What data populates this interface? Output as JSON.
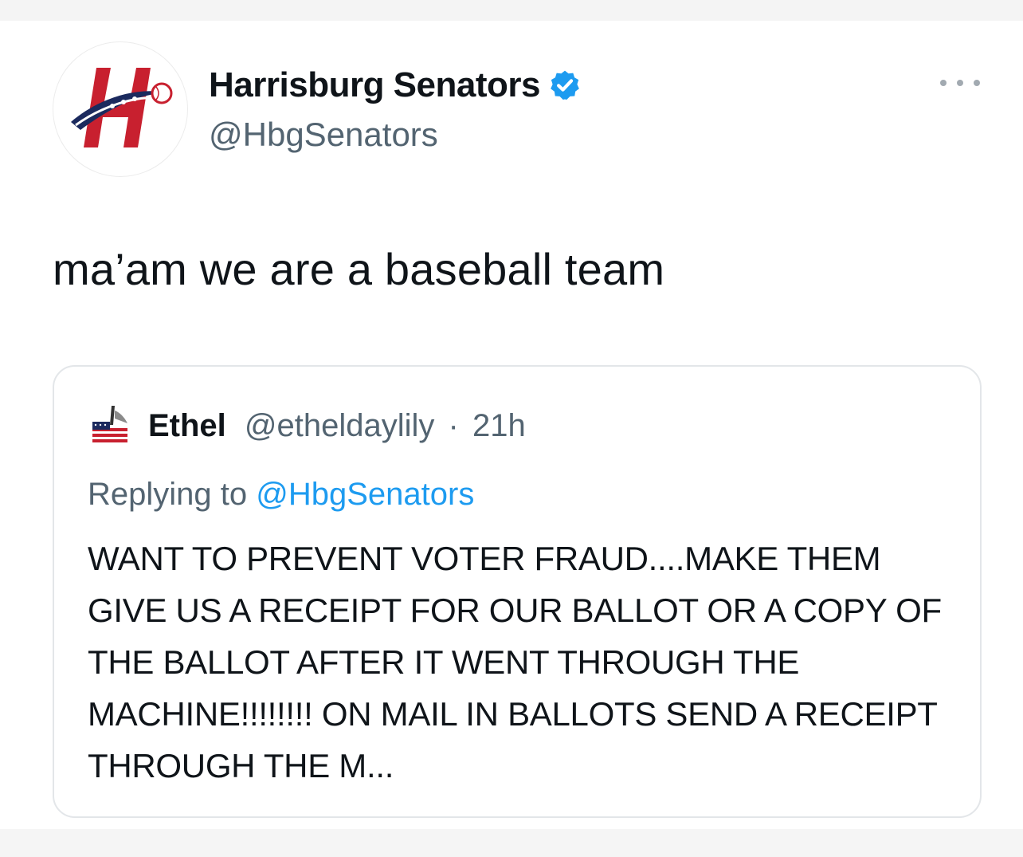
{
  "tweet": {
    "display_name": "Harrisburg Senators",
    "handle": "@HbgSenators",
    "verified": true,
    "text": "ma’am we are a baseball team",
    "avatar_icon": "harrisburg-senators-logo",
    "more_icon": "more-dots-icon"
  },
  "quoted_tweet": {
    "display_name": "Ethel",
    "handle": "@etheldaylily",
    "separator": "·",
    "time": "21h",
    "replying_prefix": "Replying to ",
    "replying_to": "@HbgSenators",
    "text": "WANT TO PREVENT VOTER FRAUD....MAKE THEM GIVE US A RECEIPT FOR OUR BALLOT OR A COPY OF THE BALLOT AFTER IT WENT THROUGH THE MACHINE!!!!!!!! ON MAIL IN BALLOTS SEND A RECEIPT THROUGH THE M...",
    "avatar_icon": "flag-avatar-icon"
  },
  "colors": {
    "text_primary": "#0f1419",
    "text_secondary": "#536471",
    "link_blue": "#1d9bf0",
    "verified_blue": "#1d9bf0",
    "logo_red": "#c8202f",
    "logo_navy": "#1b2a5e"
  }
}
